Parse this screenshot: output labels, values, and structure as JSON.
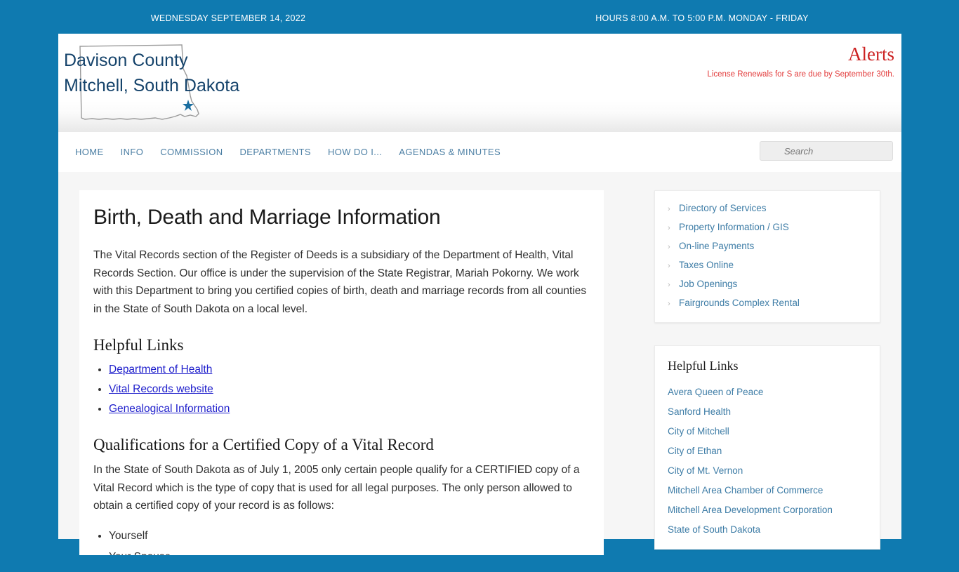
{
  "topbar": {
    "date": "WEDNESDAY SEPTEMBER 14, 2022",
    "hours": "HOURS 8:00 A.M. TO 5:00 P.M. MONDAY - FRIDAY",
    "bg_color": "#0f7ab0"
  },
  "masthead": {
    "logo_line1": "Davison County",
    "logo_line2": "Mitchell, South Dakota",
    "logo_text": "Davison County\nMitchell, South Dakota",
    "logo_color": "#15436b",
    "map_icon": "south-dakota-outline-icon",
    "star_icon": "star-marker-icon",
    "alerts_title": "Alerts",
    "alerts_title_color": "#cc2222",
    "alerts_message": "License Renewals for S are due by September 30th."
  },
  "nav": {
    "items": [
      {
        "label": "HOME",
        "name": "nav-item-home"
      },
      {
        "label": "INFO",
        "name": "nav-item-info"
      },
      {
        "label": "COMMISSION",
        "name": "nav-item-commission"
      },
      {
        "label": "DEPARTMENTS",
        "name": "nav-item-departments"
      },
      {
        "label": "HOW DO I...",
        "name": "nav-item-how-do-i"
      },
      {
        "label": "AGENDAS & MINUTES",
        "name": "nav-item-agendas-minutes"
      }
    ],
    "link_color": "#4c7fa4"
  },
  "search": {
    "placeholder": "Search",
    "value": "",
    "icon": "search-icon"
  },
  "main": {
    "title": "Birth, Death and Marriage Information",
    "intro_paragraph": "The Vital Records section of the Register of Deeds is a subsidiary of the Department of Health, Vital Records Section. Our office is under the supervision of the State Registrar, Mariah Pokorny. We work with this Department to bring you certified copies of birth, death and marriage records from all counties in the State of South Dakota on a local level.",
    "helpful_links_heading": "Helpful Links",
    "helpful_links": [
      "Department of Health",
      "Vital Records website",
      "Genealogical Information"
    ],
    "qualifications_heading": "Qualifications for a Certified Copy of a Vital Record",
    "qualifications_paragraph": "In the State of South Dakota as of July 1, 2005 only certain people qualify for a CERTIFIED copy of a Vital Record which is the type of copy that is used for all legal purposes. The only person allowed to obtain a certified copy of your record is as follows:",
    "qualifications_list": [
      "Yourself",
      "Your Spouse"
    ]
  },
  "sidebar": {
    "quick_links": [
      "Directory of Services",
      "Property Information / GIS",
      "On-line Payments",
      "Taxes Online",
      "Job Openings",
      "Fairgrounds Complex Rental"
    ],
    "helpful_links_heading": "Helpful Links",
    "helpful_links": [
      "Avera Queen of Peace",
      "Sanford Health",
      "City of Mitchell",
      "City of Ethan",
      "City of Mt. Vernon",
      "Mitchell Area Chamber of Commerce",
      "Mitchell Area Development Corporation",
      "State of South Dakota"
    ],
    "link_color": "#3d7ca6",
    "bullet_icon": "chevron-right-icon"
  }
}
